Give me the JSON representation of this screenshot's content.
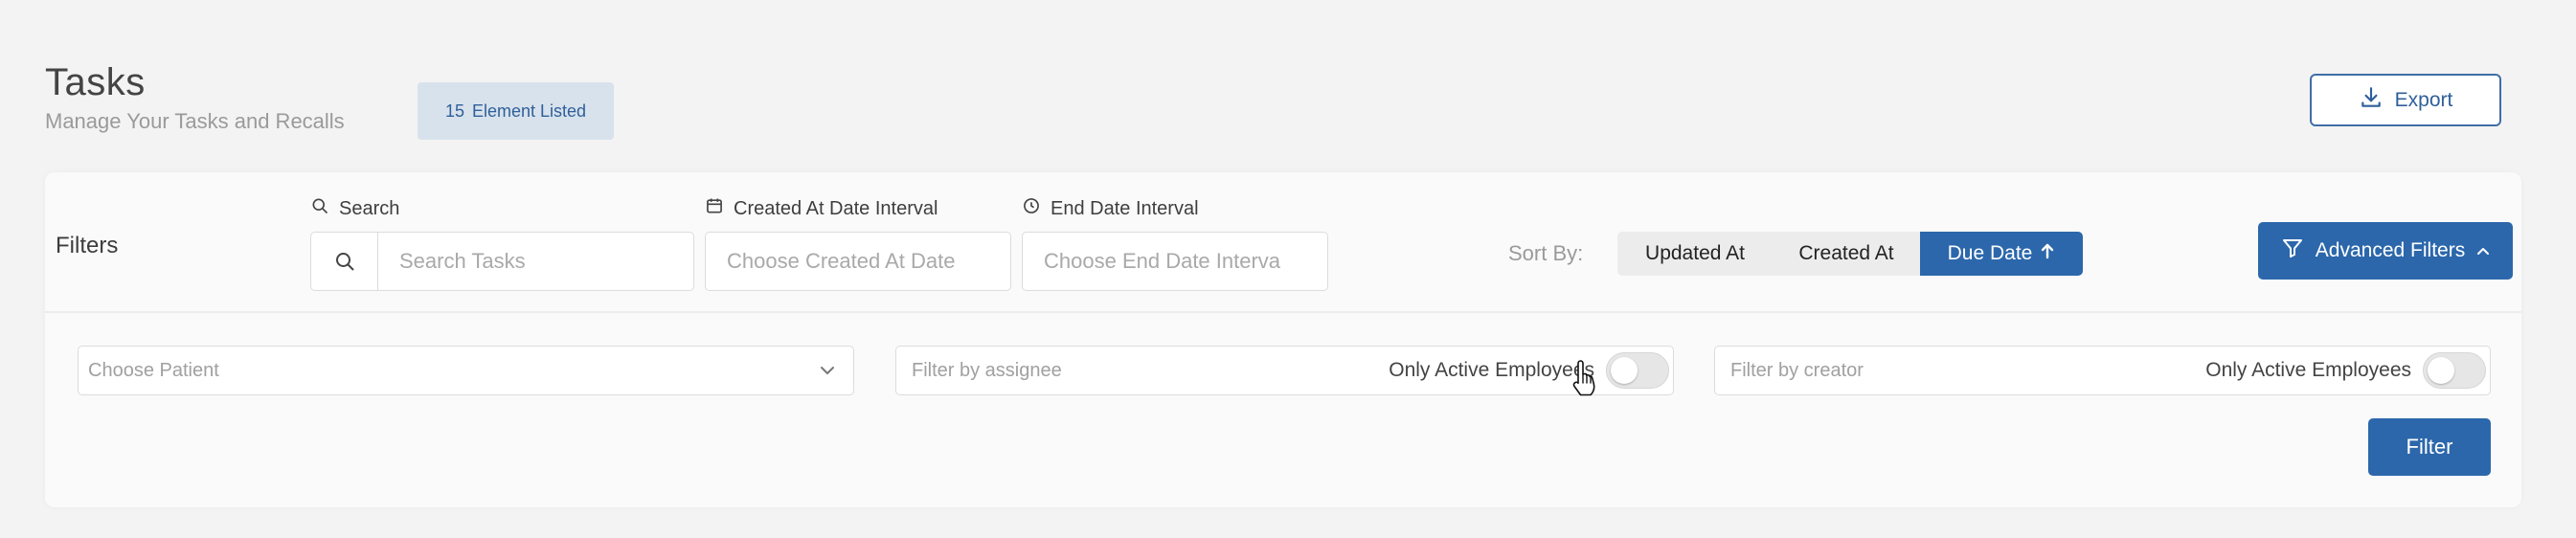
{
  "header": {
    "title": "Tasks",
    "subtitle": "Manage Your Tasks and Recalls",
    "count": "15",
    "count_label": "Element Listed",
    "export_label": "Export"
  },
  "filters": {
    "heading": "Filters",
    "search": {
      "label": "Search",
      "placeholder": "Search Tasks"
    },
    "created": {
      "label": "Created At Date Interval",
      "placeholder": "Choose Created At Date"
    },
    "end": {
      "label": "End Date Interval",
      "placeholder": "Choose End Date Interva"
    },
    "sort": {
      "label": "Sort By:",
      "options": [
        "Updated At",
        "Created At",
        "Due Date"
      ],
      "active": "Due Date",
      "direction_glyph": "↑"
    },
    "advanced_label": "Advanced Filters",
    "advanced_glyph": "^",
    "patient": {
      "placeholder": "Choose Patient"
    },
    "assignee": {
      "placeholder": "Filter by assignee",
      "toggle_label": "Only Active Employees",
      "toggle_on": false
    },
    "creator": {
      "placeholder": "Filter by creator",
      "toggle_label": "Only Active Employees",
      "toggle_on": false
    },
    "submit_label": "Filter"
  },
  "colors": {
    "accent": "#2c67ab",
    "badge_bg": "#d8e2ec",
    "background": "#f3f3f3"
  },
  "icons": [
    "search-icon",
    "calendar-icon",
    "clock-icon",
    "download-icon",
    "funnel-icon",
    "chevron-down-icon",
    "chevron-up-icon",
    "arrow-up-icon",
    "hand-cursor-icon"
  ]
}
